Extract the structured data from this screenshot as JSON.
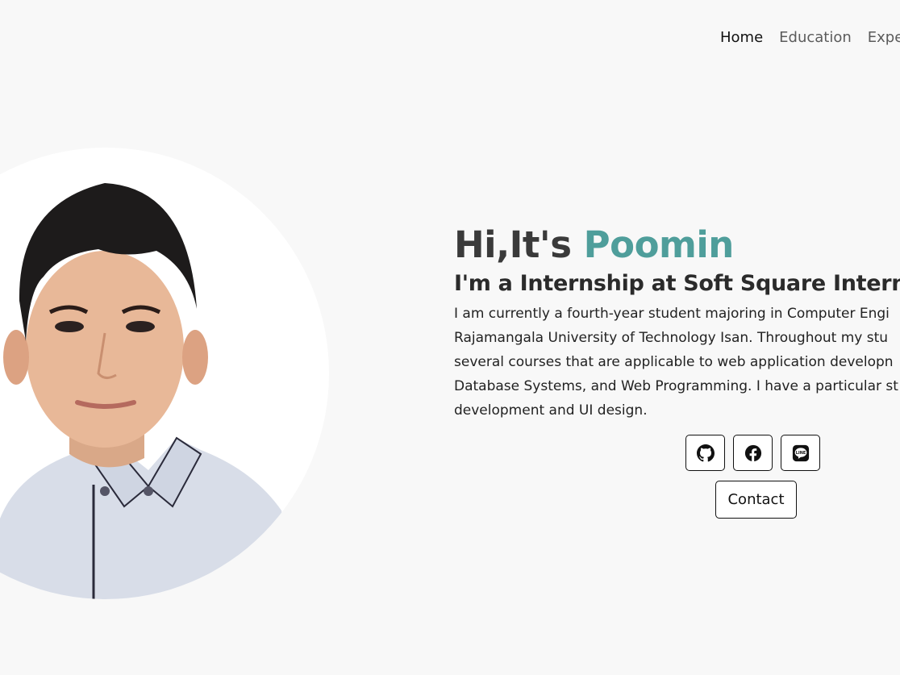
{
  "nav": {
    "items": [
      {
        "label": "Home",
        "active": true
      },
      {
        "label": "Education",
        "active": false
      },
      {
        "label": "Expe",
        "active": false
      }
    ]
  },
  "hero": {
    "greeting_prefix": "Hi,It's ",
    "name": "Poomin",
    "role": "I'm a Internship at Soft Square Internation",
    "bio_lines": [
      "I am currently a fourth-year student majoring in Computer Engi",
      "Rajamangala University of Technology Isan. Throughout my stu",
      "several courses that are applicable to web application developn",
      "Database Systems, and Web Programming. I have a particular st",
      "development and UI design."
    ]
  },
  "socials": [
    {
      "icon": "github-icon"
    },
    {
      "icon": "facebook-icon"
    },
    {
      "icon": "line-icon"
    }
  ],
  "contact_label": "Contact",
  "colors": {
    "accent": "#4f9e9b",
    "background": "#f8f8f8",
    "text": "#3a3a3a"
  }
}
